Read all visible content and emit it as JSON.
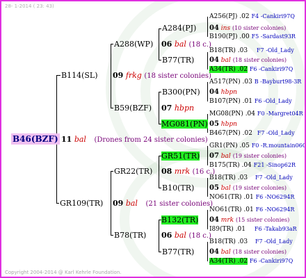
{
  "header": {
    "datestamp": "28-  1-2014 ( 23: 43)"
  },
  "footer": {
    "copyright": "Copyright 2004-2014 @ Karl Kehrle Foundation."
  },
  "root": {
    "name": "B46(BZF)",
    "num": "11",
    "race": "bal",
    "remark": "(Drones from 24 sister colonies)"
  },
  "gen1": {
    "top": {
      "name": "B114(SL)",
      "num": "09",
      "race": "frkg",
      "remark": "(18 sister colonies)"
    },
    "bottom": {
      "name": "GR109(TR)",
      "num": "09",
      "race": "bal",
      "remark": "(21 sister colonies)"
    }
  },
  "gen2": {
    "a": {
      "name": "A288(WP)",
      "num": "06",
      "race": "bal",
      "remark": "(18 c.)"
    },
    "b": {
      "name": "B59(BZF)",
      "num": "07",
      "race": "hbpn",
      "remark": ""
    },
    "c": {
      "name": "GR22(TR)",
      "num": "08",
      "race": "mrk",
      "remark": "(16 c.)"
    },
    "d": {
      "name": "B78(TR)",
      "num": "06",
      "race": "bal",
      "remark": "(18 c.)"
    }
  },
  "gen3": {
    "a": {
      "name": "A284(PJ)",
      "num": "04",
      "race": "ins",
      "remark": "(10 sister colonies)"
    },
    "b": {
      "name": "B77(TR)",
      "num": "04",
      "race": "bal",
      "remark": "(18 sister colonies)"
    },
    "c": {
      "name": "B300(PN)",
      "num": "04",
      "race": "hbpn",
      "remark": ""
    },
    "d": {
      "name": "MG081(PN)",
      "num": "05",
      "race": "hbpn",
      "remark": ""
    },
    "e": {
      "name": "GR51(TR)",
      "num": "07",
      "race": "bal",
      "remark": "(19 sister colonies)"
    },
    "f": {
      "name": "B10(TR)",
      "num": "05",
      "race": "bal",
      "remark": "(19 sister colonies)"
    },
    "g": {
      "name": "B132(TR)",
      "num": "04",
      "race": "mrk",
      "remark": "(15 sister colonies)"
    },
    "h": {
      "name": "B77(TR)",
      "num": "04",
      "race": "bal",
      "remark": "(18 sister colonies)"
    }
  },
  "gen4": {
    "r1": {
      "name": "A256(PJ)",
      "year": ".02",
      "info": "F4 -Cankiri97Q"
    },
    "r2": {
      "name": "B190(PJ)",
      "year": ".00",
      "info": "F5 -Sardast93R"
    },
    "r3": {
      "name": "B18(TR)",
      "year": ".03",
      "info": "F7 -Old_Lady"
    },
    "r4": {
      "name": "A34(TR)",
      "year": ".02",
      "info": "F6 -Cankiri97Q"
    },
    "r5": {
      "name": "A517(PN)",
      "year": ".03",
      "info": "B -Bayburt98-3R"
    },
    "r6": {
      "name": "B107(PN)",
      "year": ".01",
      "info": "F6 -Old_Lady"
    },
    "r7": {
      "name": "MG08(PN)",
      "year": ".04",
      "info": "F0 -Margret04R"
    },
    "r8": {
      "name": "B467(PN)",
      "year": ".02",
      "info": "F7 -Old_Lady"
    },
    "r9": {
      "name": "GR1(PN)",
      "year": ".05",
      "info": "F0 -R.mountain06Q"
    },
    "r10": {
      "name": "B175(TR)",
      "year": ".04",
      "info": "F21 -Sinop62R"
    },
    "r11": {
      "name": "B18(TR)",
      "year": ".03",
      "info": "F7 -Old_Lady"
    },
    "r12": {
      "name": "NO61(TR)",
      "year": ".01",
      "info": "F6 -NO6294R"
    },
    "r13": {
      "name": "NO61(TR)",
      "year": ".01",
      "info": "F6 -NO6294R"
    },
    "r14": {
      "name": "I89(TR)",
      "year": ".01",
      "info": "F6 -Takab93aR"
    },
    "r15": {
      "name": "B18(TR)",
      "year": ".03",
      "info": "F7 -Old_Lady"
    },
    "r16": {
      "name": "A34(TR)",
      "year": ".02",
      "info": "F6 -Cankiri97Q"
    }
  }
}
